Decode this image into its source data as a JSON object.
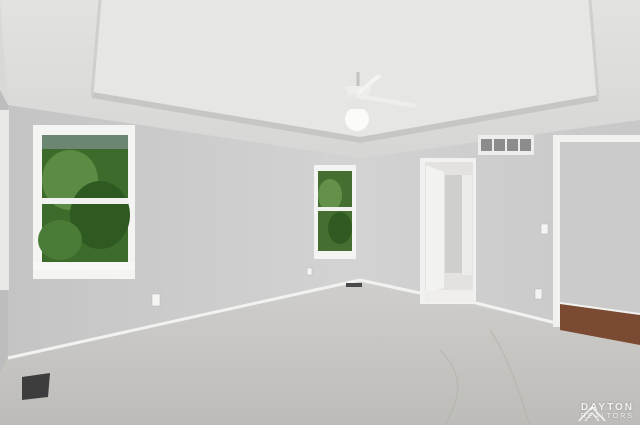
{
  "photo": {
    "subject": "empty-bedroom",
    "colors": {
      "wall": "#cfcfcf",
      "ceiling": "#e4e4e2",
      "carpet": "#c9c8c4",
      "trim": "#f3f3f1",
      "foliage": "#3f6f2e",
      "hardwood": "#7a4a32"
    }
  },
  "watermark": {
    "brand": "DAYTON",
    "sub": "REALTORS"
  }
}
